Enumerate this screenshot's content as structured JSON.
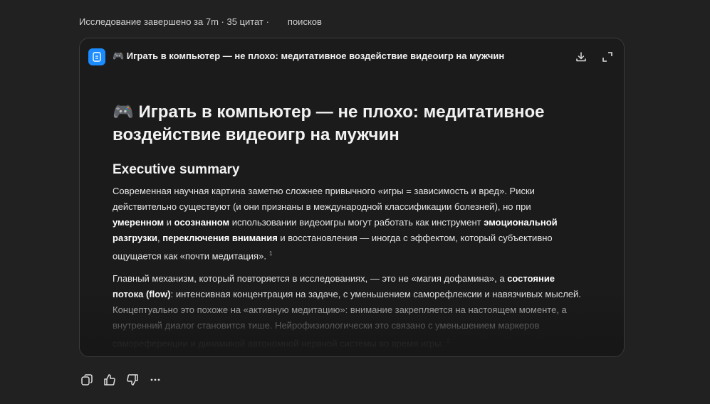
{
  "status": {
    "prefix": "Исследование завершено за 7m · 35 цитат ·",
    "suffix": "поисков"
  },
  "card": {
    "title": "🎮 Играть в компьютер — не плохо: медитативное воздействие видеоигр на мужчин",
    "doc_title": "🎮 Играть в компьютер — не плохо: медитативное воздействие видеоигр на мужчин",
    "section": "Executive summary",
    "p1": [
      "Современная научная картина заметно сложнее привычного «игры = зависимость и вред». Риски действительно существуют (и они признаны в международной классификации болезней), но при ",
      "умеренном",
      " и ",
      "осознанном",
      " использовании видеоигры могут работать как инструмент ",
      "эмоциональной разгрузки",
      ", ",
      "переключения внимания",
      " и восстановления — иногда с эффектом, который субъективно ощущается как «почти медитация».",
      "1"
    ],
    "p2": [
      "Главный механизм, который повторяется в исследованиях, — это не «магия дофамина», а ",
      "состояние потока (flow)",
      ": интенсивная концентрация на задаче, с уменьшением саморефлексии и навязчивых мыслей. Концептуально это похоже на «активную медитацию»: внимание закрепляется на настоящем моменте, а внутренний диалог становится тише. Нейрофизиологически это связано с уменьшением маркеров самореференции и динамикой автономной нервной системы во время игры.",
      "2"
    ]
  },
  "colors": {
    "accent": "#1a8cff"
  }
}
